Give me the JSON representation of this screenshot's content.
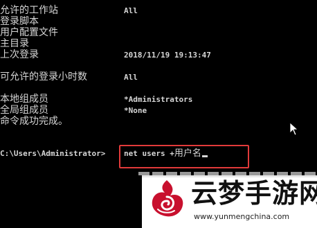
{
  "console": {
    "lines": [
      {
        "label": "允许的工作站",
        "value": "All"
      },
      {
        "label": "登录脚本",
        "value": ""
      },
      {
        "label": "用户配置文件",
        "value": ""
      },
      {
        "label": "主目录",
        "value": ""
      },
      {
        "label": "上次登录",
        "value": "2018/11/19 19:13:47"
      },
      {
        "label": "可允许的登录小时数",
        "value": "All"
      },
      {
        "label": "本地组成员",
        "value": "*Administrators"
      },
      {
        "label": "全局组成员",
        "value": "*None"
      },
      {
        "label": "命令成功完成。",
        "value": ""
      }
    ],
    "prompt": "C:\\Users\\Administrator>",
    "command_prefix": "net users +",
    "command_suffix": "用户名"
  },
  "colors": {
    "background": "#000000",
    "text": "#d6d6d6",
    "highlight_border": "#e23a3a"
  },
  "watermark": {
    "title": "云梦手游网",
    "url": "www.yunmengchina.com",
    "logo_icon": "yunmeng-logo-icon"
  }
}
